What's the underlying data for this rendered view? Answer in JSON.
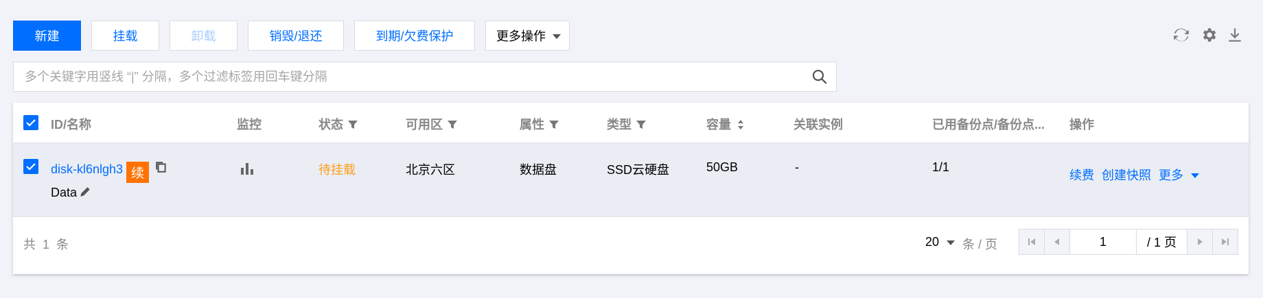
{
  "toolbar": {
    "new_label": "新建",
    "mount_label": "挂载",
    "unmount_label": "卸载",
    "destroy_label": "销毁/退还",
    "expiry_label": "到期/欠费保护",
    "more_label": "更多操作"
  },
  "top_icons": [
    "refresh-icon",
    "settings-icon",
    "download-icon"
  ],
  "search": {
    "placeholder": "多个关键字用竖线 “|” 分隔，多个过滤标签用回车键分隔"
  },
  "table": {
    "headers": {
      "id": "ID/名称",
      "monitor": "监控",
      "status": "状态",
      "zone": "可用区",
      "attr": "属性",
      "type": "类型",
      "capacity": "容量",
      "instance": "关联实例",
      "backup": "已用备份点/备份点...",
      "ops": "操作"
    },
    "rows": [
      {
        "id": "disk-kl6nlgh3",
        "badge": "续",
        "name": "Data",
        "status": "待挂载",
        "zone": "北京六区",
        "attr": "数据盘",
        "type": "SSD云硬盘",
        "capacity": "50GB",
        "instance": "-",
        "backup": "1/1",
        "op_renew": "续费",
        "op_snapshot": "创建快照",
        "op_more": "更多"
      }
    ]
  },
  "footer": {
    "total_text": "共  1  条",
    "page_size": "20",
    "per_page": "条 / 页",
    "current_page": "1",
    "total_pages": "/ 1 页"
  },
  "colors": {
    "accent": "#006eff",
    "warning": "#ff9c19",
    "badge": "#ff7200"
  }
}
